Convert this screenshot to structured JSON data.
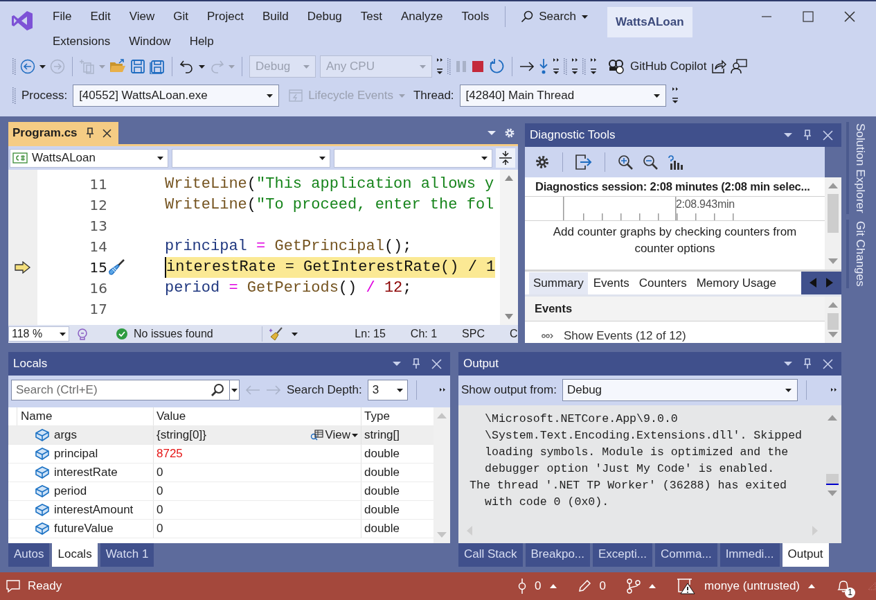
{
  "menu_rows": [
    {
      "items": [
        "File",
        "Edit",
        "View",
        "Git",
        "Project",
        "Build",
        "Debug",
        "Test",
        "Analyze",
        "Tools"
      ]
    },
    {
      "items": [
        "Extensions",
        "Window",
        "Help"
      ]
    }
  ],
  "search": {
    "label": "Search"
  },
  "window": {
    "title": "WattsALoan"
  },
  "toolbar": {
    "configuration": {
      "value": "Debug",
      "disabled": true
    },
    "platform": {
      "value": "Any CPU",
      "disabled": true
    },
    "copilot": "GitHub Copilot"
  },
  "debug_location": {
    "process_label": "Process:",
    "process": "[40552] WattsALoan.exe",
    "lifecycle": {
      "label": "Lifecycle Events",
      "disabled": true
    },
    "thread_label": "Thread:",
    "thread": "[42840] Main Thread"
  },
  "editor": {
    "tab": {
      "title": "Program.cs",
      "selected": true
    },
    "project": "WattsALoan",
    "lines": [
      {
        "number": "11",
        "current": false,
        "tokens": [
          {
            "kind": "method",
            "text": "WriteLine"
          },
          {
            "kind": "punct",
            "text": "("
          },
          {
            "kind": "string",
            "text": "\"This application allows y"
          }
        ]
      },
      {
        "number": "12",
        "current": false,
        "tokens": [
          {
            "kind": "method",
            "text": "WriteLine"
          },
          {
            "kind": "punct",
            "text": "("
          },
          {
            "kind": "string",
            "text": "\"To proceed, enter the fol"
          }
        ]
      },
      {
        "number": "13",
        "current": false
      },
      {
        "number": "14",
        "current": false,
        "tokens": [
          {
            "kind": "variable",
            "text": "principal"
          },
          {
            "kind": "operator",
            "text": " = "
          },
          {
            "kind": "method",
            "text": "GetPrincipal"
          },
          {
            "kind": "punct",
            "text": "();"
          }
        ]
      },
      {
        "number": "15",
        "current": true,
        "tokens": [
          {
            "kind": "variable",
            "text": "interestRate"
          },
          {
            "kind": "operator",
            "text": " = "
          },
          {
            "kind": "method",
            "text": "GetInterestRate"
          },
          {
            "kind": "punct",
            "text": "() "
          },
          {
            "kind": "operator",
            "text": "/ "
          },
          {
            "kind": "number",
            "text": "1"
          }
        ]
      },
      {
        "number": "16",
        "current": false,
        "tokens": [
          {
            "kind": "variable",
            "text": "period"
          },
          {
            "kind": "operator",
            "text": " = "
          },
          {
            "kind": "method",
            "text": "GetPeriods"
          },
          {
            "kind": "punct",
            "text": "() "
          },
          {
            "kind": "operator",
            "text": "/ "
          },
          {
            "kind": "number",
            "text": "12"
          },
          {
            "kind": "punct",
            "text": ";"
          }
        ]
      },
      {
        "number": "17",
        "current": false
      }
    ],
    "status": {
      "zoom": "118 %",
      "issues": "No issues found",
      "line": "Ln: 15",
      "column": "Ch: 1",
      "whitespace": "SPC",
      "encoding": "C"
    }
  },
  "diagnostic_tools": {
    "title": "Diagnostic Tools",
    "session": "Diagnostics session: 2:08 minutes (2:08 min selec...",
    "timeline_label": "2:08.943min",
    "message": "Add counter graphs by checking counters from counter options",
    "tabs": [
      {
        "label": "Summary",
        "selected": true
      },
      {
        "label": "Events",
        "selected": false
      },
      {
        "label": "Counters",
        "selected": false
      },
      {
        "label": "Memory Usage",
        "selected": false
      }
    ],
    "events_header": "Events",
    "show_events": "Show Events (12 of 12)"
  },
  "locals": {
    "title": "Locals",
    "search": {
      "placeholder": "Search (Ctrl+E)"
    },
    "depth_label": "Search Depth:",
    "depth": "3",
    "columns": [
      "Name",
      "Value",
      "Type"
    ],
    "rows": [
      {
        "name": "args",
        "value": "{string[0]}",
        "type": "string[]",
        "selected": true,
        "changed": false,
        "visualizer": "View"
      },
      {
        "name": "principal",
        "value": "8725",
        "type": "double",
        "selected": false,
        "changed": true
      },
      {
        "name": "interestRate",
        "value": "0",
        "type": "double",
        "selected": false,
        "changed": false
      },
      {
        "name": "period",
        "value": "0",
        "type": "double",
        "selected": false,
        "changed": false
      },
      {
        "name": "interestAmount",
        "value": "0",
        "type": "double",
        "selected": false,
        "changed": false
      },
      {
        "name": "futureValue",
        "value": "0",
        "type": "double",
        "selected": false,
        "changed": false
      }
    ],
    "tabs": [
      {
        "label": "Autos",
        "selected": false
      },
      {
        "label": "Locals",
        "selected": true
      },
      {
        "label": "Watch 1",
        "selected": false
      }
    ]
  },
  "output": {
    "title": "Output",
    "source_label": "Show output from:",
    "source": "Debug",
    "lines": [
      {
        "kind": "wrap",
        "text": "\\Microsoft.NETCore.App\\9.0.0"
      },
      {
        "kind": "wrap",
        "text": "\\System.Text.Encoding.Extensions.dll'. Skipped"
      },
      {
        "kind": "wrap",
        "text": "loading symbols. Module is optimized and the"
      },
      {
        "kind": "wrap",
        "text": "debugger option 'Just My Code' is enabled."
      },
      {
        "kind": "start",
        "text": "The thread '.NET TP Worker' (36288) has exited"
      },
      {
        "kind": "wrap",
        "text": "with code 0 (0x0)."
      }
    ],
    "tabs": [
      {
        "label": "Call Stack",
        "selected": false
      },
      {
        "label": "Breakpo...",
        "selected": false
      },
      {
        "label": "Excepti...",
        "selected": false
      },
      {
        "label": "Comma...",
        "selected": false
      },
      {
        "label": "Immedi...",
        "selected": false
      },
      {
        "label": "Output",
        "selected": true
      }
    ]
  },
  "side_tabs": [
    "Solution Explorer",
    "Git Changes"
  ],
  "status_bar": {
    "text": "Ready",
    "incoming": "0",
    "changes": "0",
    "repository": "monye (untrusted)",
    "notifications": "1"
  }
}
